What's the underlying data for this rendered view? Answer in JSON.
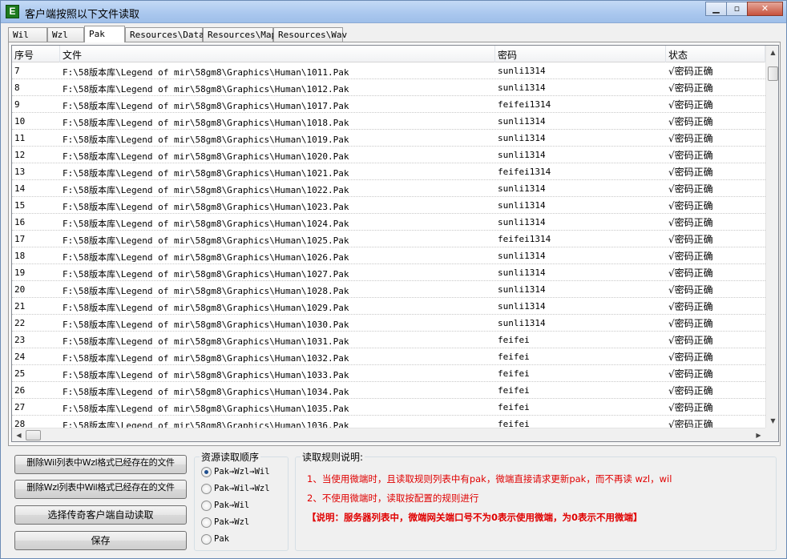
{
  "window": {
    "title": "客户端按照以下文件读取",
    "icon_letter": "E"
  },
  "window_buttons": {
    "minimize": "▁",
    "maximize": "▫",
    "close": "✕"
  },
  "tabs": [
    {
      "label": "Wil",
      "active": false
    },
    {
      "label": "Wzl",
      "active": false
    },
    {
      "label": "Pak",
      "active": true
    },
    {
      "label": "Resources\\Data",
      "active": false
    },
    {
      "label": "Resources\\Map",
      "active": false
    },
    {
      "label": "Resources\\Wav",
      "active": false
    }
  ],
  "table": {
    "columns": [
      "序号",
      "文件",
      "密码",
      "状态"
    ],
    "rows": [
      [
        "7",
        "F:\\58版本库\\Legend of mir\\58gm8\\Graphics\\Human\\1011.Pak",
        "sunli1314",
        "√密码正确"
      ],
      [
        "8",
        "F:\\58版本库\\Legend of mir\\58gm8\\Graphics\\Human\\1012.Pak",
        "sunli1314",
        "√密码正确"
      ],
      [
        "9",
        "F:\\58版本库\\Legend of mir\\58gm8\\Graphics\\Human\\1017.Pak",
        "feifei1314",
        "√密码正确"
      ],
      [
        "10",
        "F:\\58版本库\\Legend of mir\\58gm8\\Graphics\\Human\\1018.Pak",
        "sunli1314",
        "√密码正确"
      ],
      [
        "11",
        "F:\\58版本库\\Legend of mir\\58gm8\\Graphics\\Human\\1019.Pak",
        "sunli1314",
        "√密码正确"
      ],
      [
        "12",
        "F:\\58版本库\\Legend of mir\\58gm8\\Graphics\\Human\\1020.Pak",
        "sunli1314",
        "√密码正确"
      ],
      [
        "13",
        "F:\\58版本库\\Legend of mir\\58gm8\\Graphics\\Human\\1021.Pak",
        "feifei1314",
        "√密码正确"
      ],
      [
        "14",
        "F:\\58版本库\\Legend of mir\\58gm8\\Graphics\\Human\\1022.Pak",
        "sunli1314",
        "√密码正确"
      ],
      [
        "15",
        "F:\\58版本库\\Legend of mir\\58gm8\\Graphics\\Human\\1023.Pak",
        "sunli1314",
        "√密码正确"
      ],
      [
        "16",
        "F:\\58版本库\\Legend of mir\\58gm8\\Graphics\\Human\\1024.Pak",
        "sunli1314",
        "√密码正确"
      ],
      [
        "17",
        "F:\\58版本库\\Legend of mir\\58gm8\\Graphics\\Human\\1025.Pak",
        "feifei1314",
        "√密码正确"
      ],
      [
        "18",
        "F:\\58版本库\\Legend of mir\\58gm8\\Graphics\\Human\\1026.Pak",
        "sunli1314",
        "√密码正确"
      ],
      [
        "19",
        "F:\\58版本库\\Legend of mir\\58gm8\\Graphics\\Human\\1027.Pak",
        "sunli1314",
        "√密码正确"
      ],
      [
        "20",
        "F:\\58版本库\\Legend of mir\\58gm8\\Graphics\\Human\\1028.Pak",
        "sunli1314",
        "√密码正确"
      ],
      [
        "21",
        "F:\\58版本库\\Legend of mir\\58gm8\\Graphics\\Human\\1029.Pak",
        "sunli1314",
        "√密码正确"
      ],
      [
        "22",
        "F:\\58版本库\\Legend of mir\\58gm8\\Graphics\\Human\\1030.Pak",
        "sunli1314",
        "√密码正确"
      ],
      [
        "23",
        "F:\\58版本库\\Legend of mir\\58gm8\\Graphics\\Human\\1031.Pak",
        "feifei",
        "√密码正确"
      ],
      [
        "24",
        "F:\\58版本库\\Legend of mir\\58gm8\\Graphics\\Human\\1032.Pak",
        "feifei",
        "√密码正确"
      ],
      [
        "25",
        "F:\\58版本库\\Legend of mir\\58gm8\\Graphics\\Human\\1033.Pak",
        "feifei",
        "√密码正确"
      ],
      [
        "26",
        "F:\\58版本库\\Legend of mir\\58gm8\\Graphics\\Human\\1034.Pak",
        "feifei",
        "√密码正确"
      ],
      [
        "27",
        "F:\\58版本库\\Legend of mir\\58gm8\\Graphics\\Human\\1035.Pak",
        "feifei",
        "√密码正确"
      ],
      [
        "28",
        "F:\\58版本库\\Legend of mir\\58gm8\\Graphics\\Human\\1036.Pak",
        "feifei",
        "√密码正确"
      ]
    ]
  },
  "scroll_arrows": {
    "up": "▲",
    "down": "▼",
    "left": "◀",
    "right": "▶"
  },
  "buttons": {
    "delete_wil": "删除Wil列表中Wzl格式已经存在的文件",
    "delete_wzl": "删除Wzl列表中Wil格式已经存在的文件",
    "auto_read": "选择传奇客户端自动读取",
    "save": "保存"
  },
  "read_order": {
    "title": "资源读取顺序",
    "options": [
      {
        "label": "Pak→Wzl→Wil",
        "checked": true
      },
      {
        "label": "Pak→Wil→Wzl",
        "checked": false
      },
      {
        "label": "Pak→Wil",
        "checked": false
      },
      {
        "label": "Pak→Wzl",
        "checked": false
      },
      {
        "label": "Pak",
        "checked": false
      }
    ]
  },
  "rules": {
    "title": "读取规则说明:",
    "line1": "1、当使用微端时，且读取规则列表中有pak，微端直接请求更新pak，而不再读 wzl，wil",
    "line2": "2、不使用微端时，读取按配置的规则进行",
    "line3": "【说明：服务器列表中，微端网关端口号不为0表示使用微端，为0表示不用微端】"
  },
  "colors": {
    "note_red": "#e00000",
    "title_bar": "#a9c7ee"
  }
}
